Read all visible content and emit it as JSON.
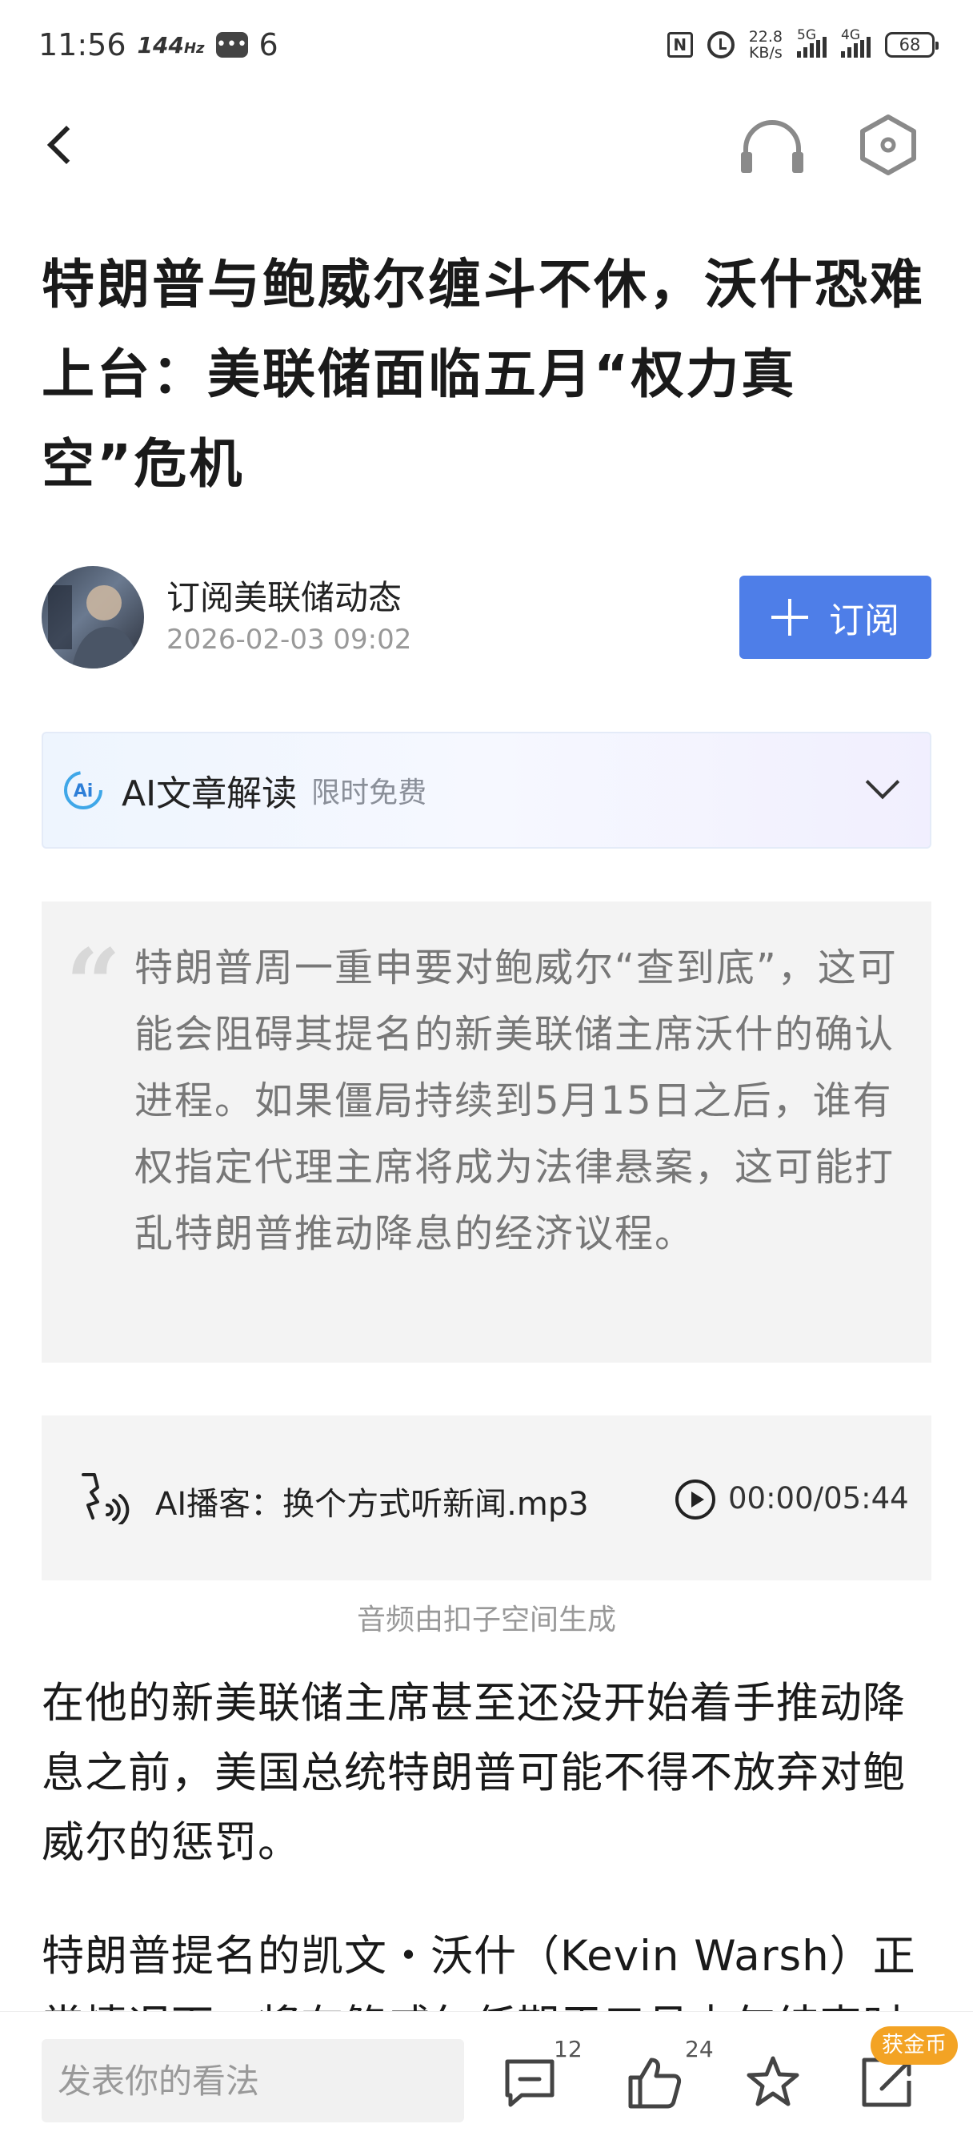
{
  "status_bar": {
    "time": "11:56",
    "refresh_rate": "144",
    "refresh_unit": "Hz",
    "chat_count": "6",
    "nfc": "N",
    "net_speed_value": "22.8",
    "net_speed_unit": "KB/s",
    "signal1_label": "5G",
    "signal2_label": "4G",
    "battery": "68"
  },
  "article": {
    "title": "特朗普与鲍威尔缠斗不休，沃什恐难上台：美联储面临五月“权力真空”危机",
    "author": "订阅美联储动态",
    "date": "2026-02-03 09:02",
    "subscribe_label": "订阅"
  },
  "ai_panel": {
    "logo": "Ai",
    "title": "AI文章解读",
    "free_tag": "限时免费"
  },
  "summary": {
    "quote_mark": "“",
    "text": "特朗普周一重申要对鲍威尔“查到底”，这可能会阻碍其提名的新美联储主席沃什的确认进程。如果僵局持续到5月15日之后，谁有权指定代理主席将成为法律悬案，这可能打乱特朗普推动降息的经济议程。"
  },
  "audio": {
    "title": "AI播客：换个方式听新闻.mp3",
    "time": "00:00/05:44",
    "note": "音频由扣子空间生成"
  },
  "body": {
    "paragraph1": "在他的新美联储主席甚至还没开始着手推动降息之前，美国总统特朗普可能不得不放弃对鲍威尔的惩罚。",
    "paragraph2": "特朗普提名的凯文・沃什（Kevin Warsh）正常情况下，将在鲍威尔任期于五月中旬结束时"
  },
  "bottom_bar": {
    "comment_placeholder": "发表你的看法",
    "comment_count": "12",
    "like_count": "24",
    "coin_badge": "获金币"
  },
  "colors": {
    "accent": "#4e7ee8",
    "coin": "#f3a324",
    "summary_bg": "#f3f3f3"
  }
}
